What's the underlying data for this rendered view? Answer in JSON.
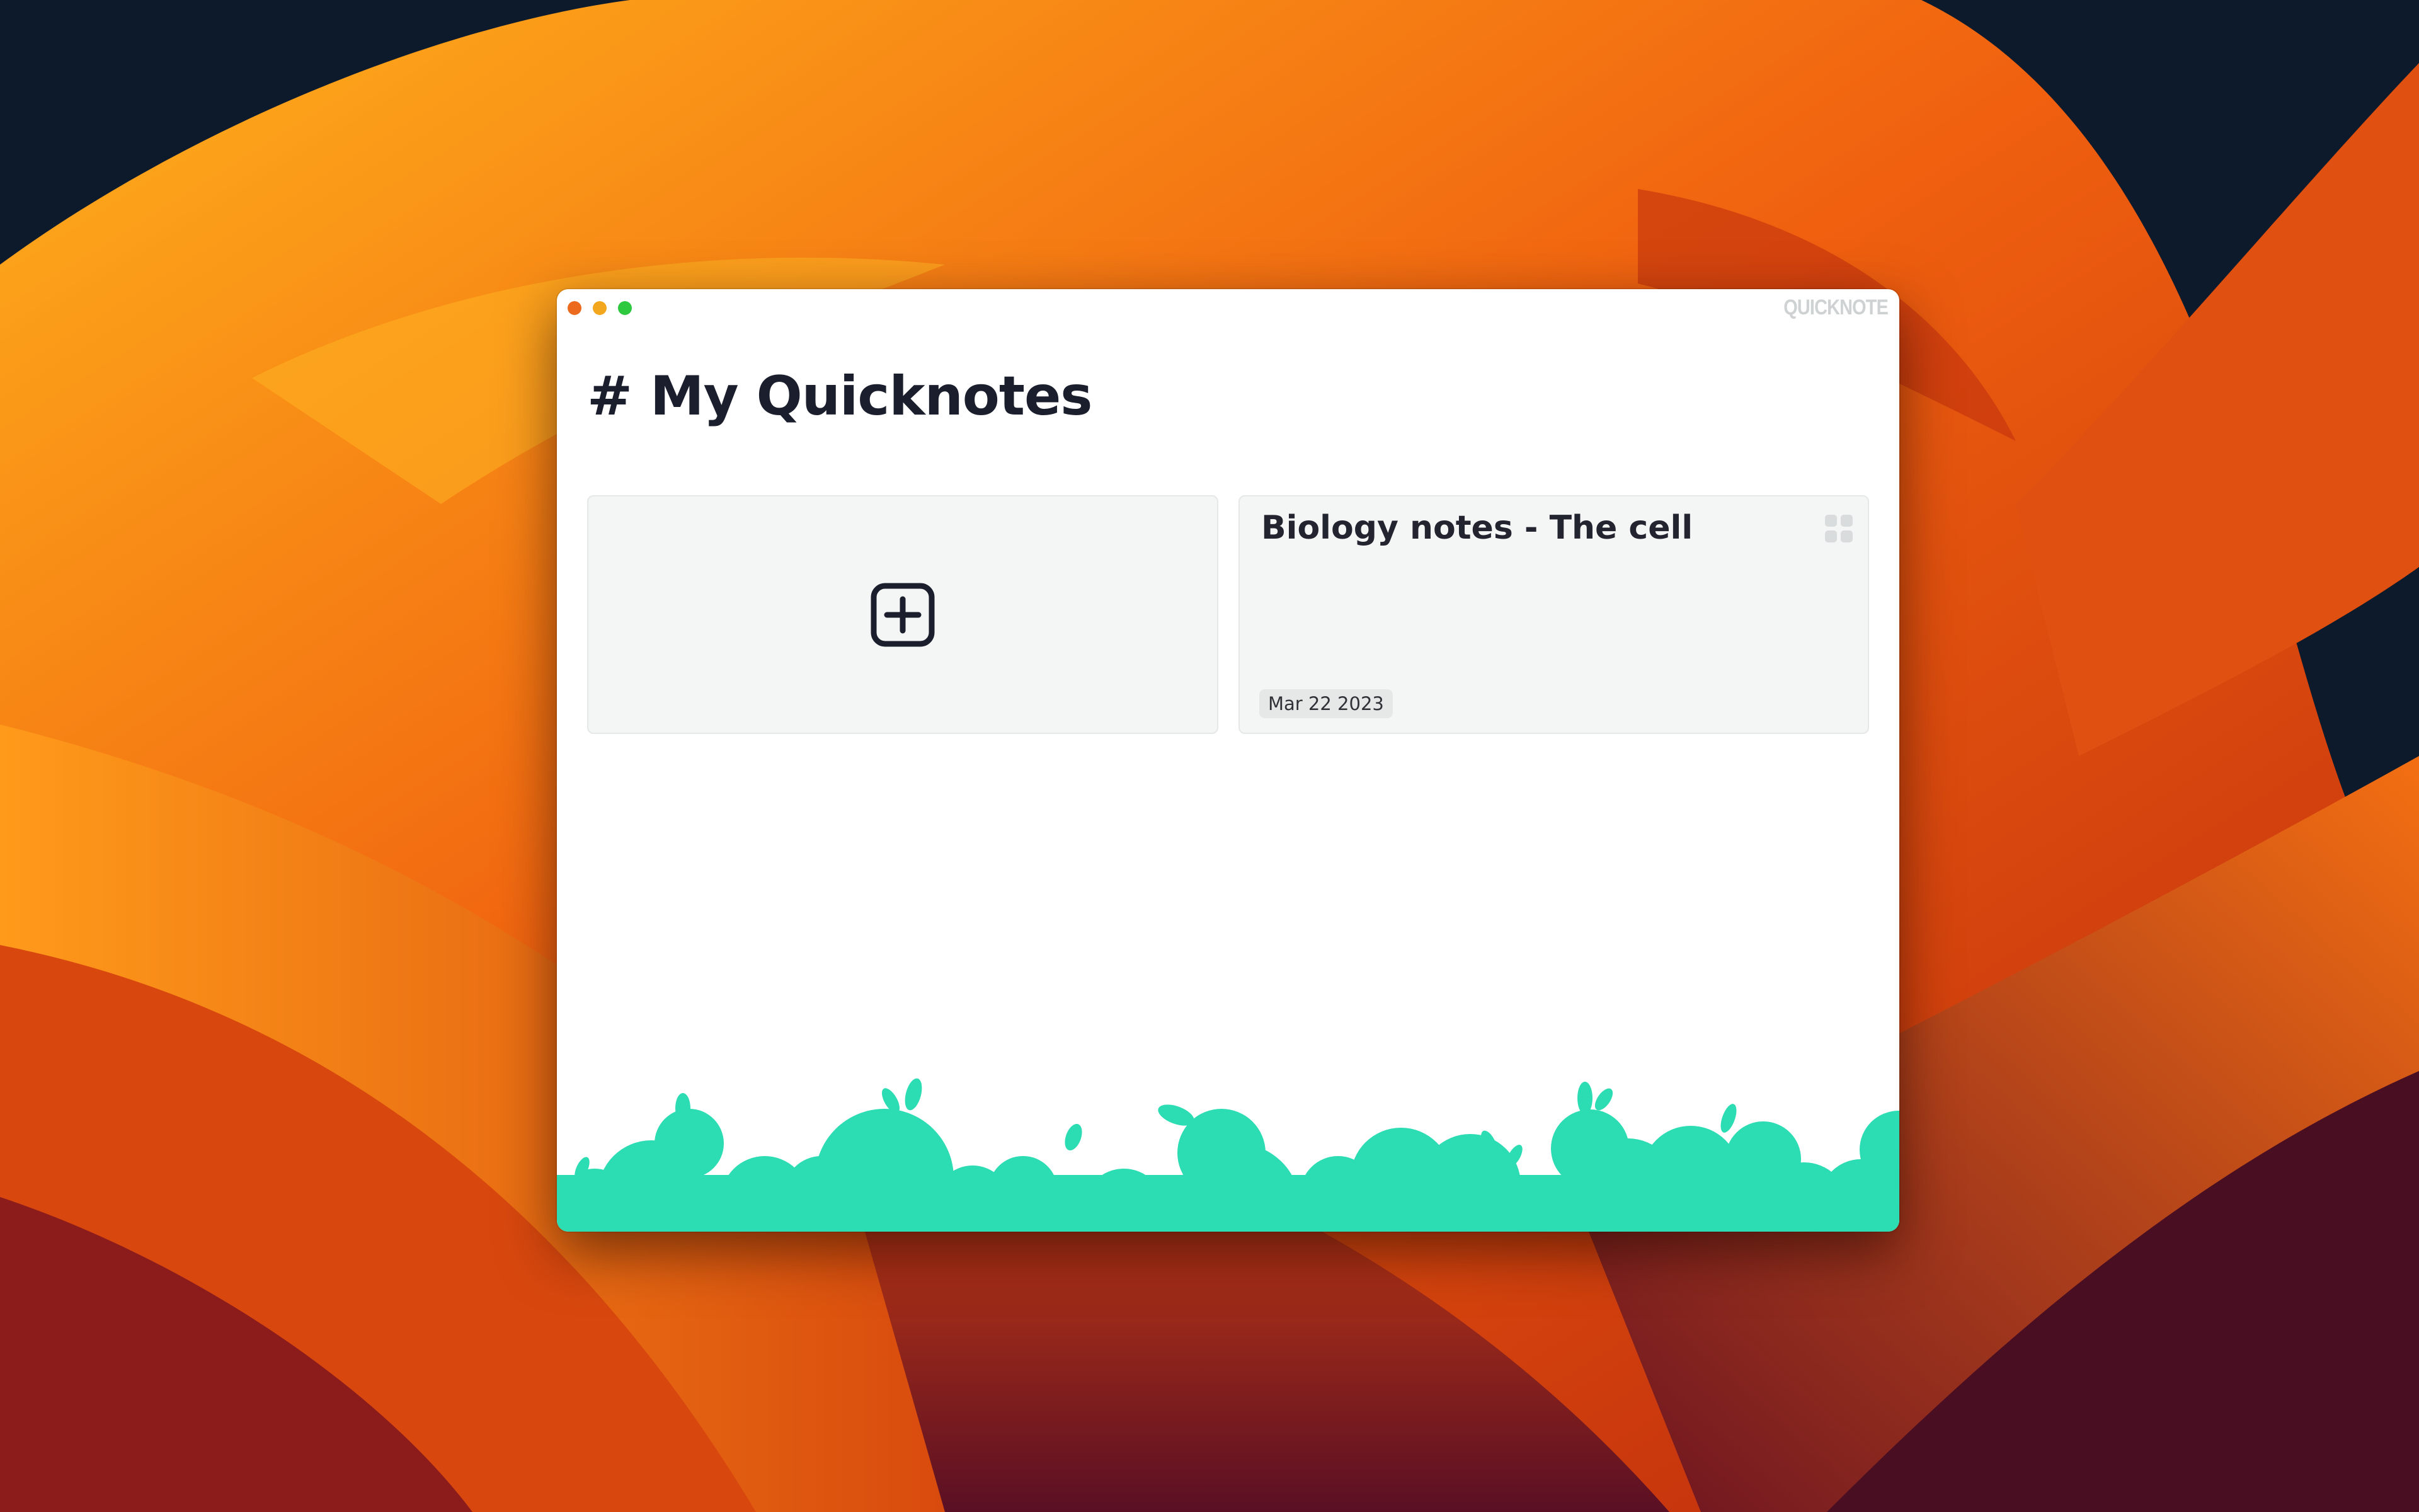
{
  "app": {
    "brand": "QUICKNOTE",
    "accent_color": "#2cdcb3"
  },
  "window_controls": [
    {
      "name": "close",
      "color": "#ec6a1e"
    },
    {
      "name": "minimize",
      "color": "#f2a71e"
    },
    {
      "name": "maximize",
      "color": "#2ec93f"
    }
  ],
  "main": {
    "title": "# My Quicknotes",
    "new_note": {
      "icon": "plus-square-icon"
    },
    "notes": [
      {
        "title": "Biology notes - The cell",
        "date": "Mar 22 2023",
        "menu_icon": "grid-icon"
      }
    ]
  }
}
